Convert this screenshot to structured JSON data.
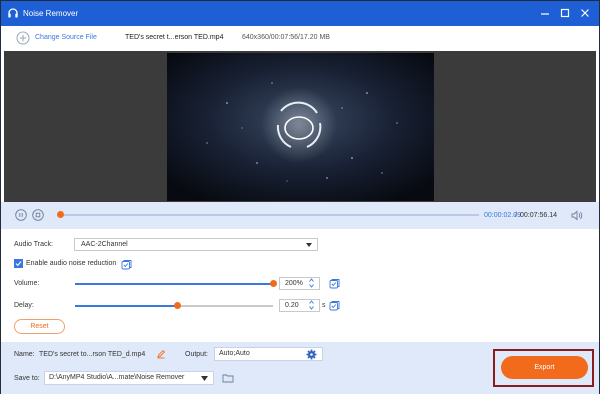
{
  "window": {
    "title": "Noise Remover"
  },
  "filebar": {
    "change_label": "Change Source File",
    "file_name": "TED's secret t...erson  TED.mp4",
    "file_info": "640x360/00:07:56/17.20 MB"
  },
  "playback": {
    "current_time": "00:00:02.09",
    "separator": "/",
    "total_time": "00:07:56.14",
    "progress": 0.004
  },
  "settings": {
    "audio_track_label": "Audio Track:",
    "audio_track_value": "AAC-2Channel",
    "noise_reduction_label": "Enable audio noise reduction",
    "noise_reduction_checked": true,
    "volume_label": "Volume:",
    "volume_value": "200%",
    "volume_level": 1.0,
    "delay_label": "Delay:",
    "delay_value": "0.20",
    "delay_unit": "s",
    "delay_level": 0.52,
    "reset_label": "Reset"
  },
  "footer": {
    "name_label": "Name:",
    "name_value": "TED's secret to...rson  TED_d.mp4",
    "output_label": "Output:",
    "output_value": "Auto;Auto",
    "save_label": "Save to:",
    "save_path": "D:\\AnyMP4 Studio\\A...mate\\Noise Remover",
    "export_label": "Export"
  },
  "colors": {
    "titlebar": "#1e5fd6",
    "accent": "#3a78e0",
    "orange": "#f26b1d",
    "panel": "#dfe9f9"
  },
  "icons": [
    "headphones-icon",
    "minimize-icon",
    "maximize-icon",
    "close-icon",
    "add-circle-icon",
    "pause-icon",
    "stop-icon",
    "speaker-icon",
    "copy-settings-icon",
    "edit-pencil-icon",
    "gear-icon",
    "folder-icon",
    "dropdown-arrow-icon"
  ]
}
